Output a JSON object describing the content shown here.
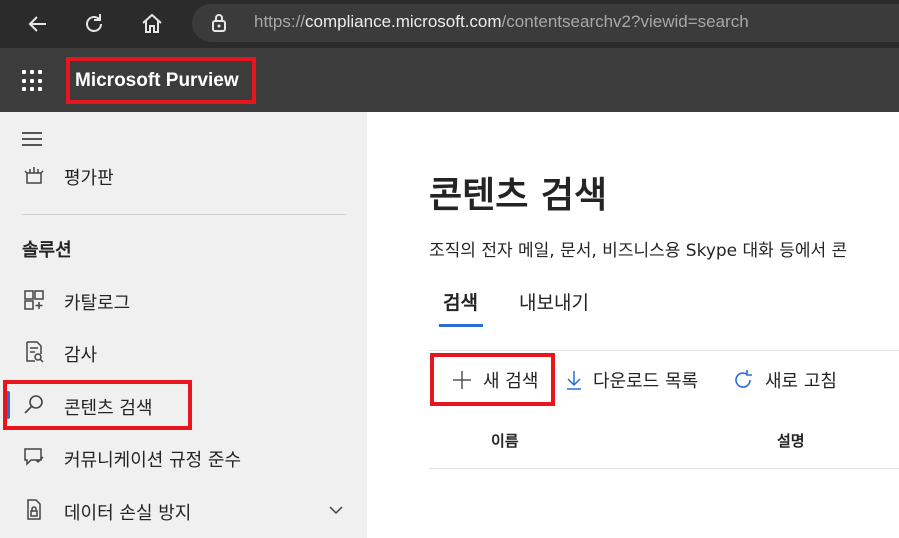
{
  "browser": {
    "url_prefix": "https://",
    "url_host": "compliance.microsoft.com",
    "url_path": "/contentsearchv2?viewid=search"
  },
  "header": {
    "brand": "Microsoft Purview"
  },
  "sidebar": {
    "items_top": [
      {
        "label": "평가판",
        "icon": "trial-icon"
      }
    ],
    "section_label": "솔루션",
    "items": [
      {
        "label": "카탈로그",
        "icon": "catalog-icon"
      },
      {
        "label": "감사",
        "icon": "audit-icon"
      },
      {
        "label": "콘텐츠 검색",
        "icon": "search-icon",
        "active": true
      },
      {
        "label": "커뮤니케이션 규정 준수",
        "icon": "communication-icon"
      },
      {
        "label": "데이터 손실 방지",
        "icon": "dlp-icon",
        "expandable": true
      }
    ]
  },
  "main": {
    "title": "콘텐츠 검색",
    "description": "조직의 전자 메일, 문서, 비즈니스용 Skype 대화 등에서 콘",
    "tabs": [
      {
        "label": "검색",
        "selected": true
      },
      {
        "label": "내보내기",
        "selected": false
      }
    ],
    "commands": {
      "new_search": "새 검색",
      "download_list": "다운로드 목록",
      "refresh": "새로 고침"
    },
    "columns": [
      "이름",
      "설명"
    ]
  },
  "colors": {
    "highlight": "#e8141e",
    "accent": "#2b6cd6"
  }
}
